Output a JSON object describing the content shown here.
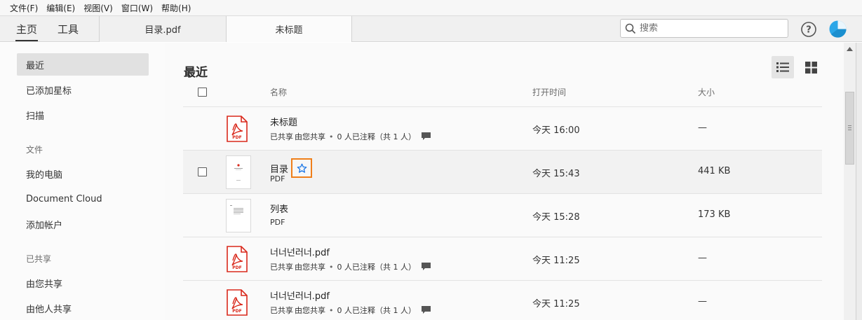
{
  "menu": [
    "文件(F)",
    "编辑(E)",
    "视图(V)",
    "窗口(W)",
    "帮助(H)"
  ],
  "tabs": {
    "home": "主页",
    "tools": "工具",
    "documents": [
      "目录.pdf",
      "未标题"
    ]
  },
  "search": {
    "placeholder": "搜索",
    "icon": "search-icon"
  },
  "sidebar": {
    "recent": "最近",
    "starred": "已添加星标",
    "scan": "扫描",
    "files_header": "文件",
    "my_computer": "我的电脑",
    "document_cloud": "Document Cloud",
    "add_account": "添加帐户",
    "shared_header": "已共享",
    "shared_by_you": "由您共享",
    "shared_by_others": "由他人共享"
  },
  "main": {
    "title": "最近",
    "columns": {
      "name": "名称",
      "opened": "打开时间",
      "size": "大小"
    },
    "files": [
      {
        "name": "未标题",
        "type": "pdf-icon",
        "shared": "已共享",
        "shared_by": "由您共享",
        "comments": "0 人已注释（共 1 人）",
        "opened": "今天 16:00",
        "size": "—"
      },
      {
        "name": "目录",
        "type": "thumbnail",
        "subtitle": "PDF",
        "opened": "今天 15:43",
        "size": "441 KB",
        "starred": true
      },
      {
        "name": "列表",
        "type": "thumbnail",
        "subtitle": "PDF",
        "opened": "今天 15:28",
        "size": "173 KB"
      },
      {
        "name": "너너넌러너.pdf",
        "type": "pdf-icon",
        "shared": "已共享",
        "shared_by": "由您共享",
        "comments": "0 人已注释（共 1 人）",
        "opened": "今天 11:25",
        "size": "—"
      },
      {
        "name": "너너넌러너.pdf",
        "type": "pdf-icon",
        "shared": "已共享",
        "shared_by": "由您共享",
        "comments": "0 人已注释（共 1 人）",
        "opened": "今天 11:25",
        "size": "—"
      }
    ]
  },
  "colors": {
    "pdf_red": "#d9281b",
    "star_highlight": "#ef7f1a",
    "star_blue": "#1473e6",
    "avatar_blue": "#2aa6e8"
  }
}
